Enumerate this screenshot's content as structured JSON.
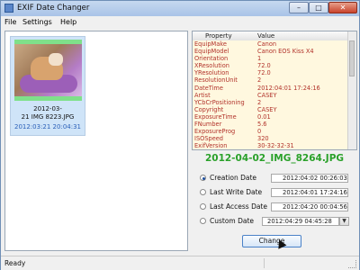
{
  "window": {
    "title": "EXIF Date Changer",
    "controls": {
      "minimize": "–",
      "maximize": "□",
      "close": "✕"
    }
  },
  "menu": [
    "File",
    "Settings",
    "Help"
  ],
  "thumbnail": {
    "line1": "2012-03-",
    "line2": "21 IMG 8223.JPG",
    "date": "2012:03:21 20:04:31"
  },
  "exif": {
    "headers": [
      "Property",
      "Value"
    ],
    "rows": [
      [
        "EquipMake",
        "Canon"
      ],
      [
        "EquipModel",
        "Canon EOS Kiss X4"
      ],
      [
        "Orientation",
        "1"
      ],
      [
        "XResolution",
        "72.0"
      ],
      [
        "YResolution",
        "72.0"
      ],
      [
        "ResolutionUnit",
        "2"
      ],
      [
        "DateTime",
        "2012:04:01 17:24:16"
      ],
      [
        "Artist",
        "CASEY"
      ],
      [
        "YCbCrPositioning",
        "2"
      ],
      [
        "Copyright",
        "CASEY"
      ],
      [
        "ExposureTime",
        "0.01"
      ],
      [
        "FNumber",
        "5.6"
      ],
      [
        "ExposureProg",
        "0"
      ],
      [
        "ISOSpeed",
        "320"
      ],
      [
        "ExifVersion",
        "30-32-32-31"
      ]
    ]
  },
  "filename": "2012-04-02_IMG_8264.JPG",
  "options": [
    {
      "label": "Creation Date",
      "value": "2012:04:02 00:26:03",
      "checked": true
    },
    {
      "label": "Last Write Date",
      "value": "2012:04:01 17:24:16",
      "checked": false
    },
    {
      "label": "Last Access Date",
      "value": "2012:04:20 00:04:56",
      "checked": false
    },
    {
      "label": "Custom Date",
      "value": "2012:04:29 04:45:28",
      "checked": false
    }
  ],
  "change_button": "Change",
  "status": "Ready",
  "colors": {
    "filename": "#2aa12a",
    "exif_text": "#b1322a",
    "thumb_date": "#2a5fb8"
  },
  "icons": {
    "window": "app-icon",
    "dropdown": "chevron-down-icon",
    "cursor": "mouse-cursor-icon"
  }
}
